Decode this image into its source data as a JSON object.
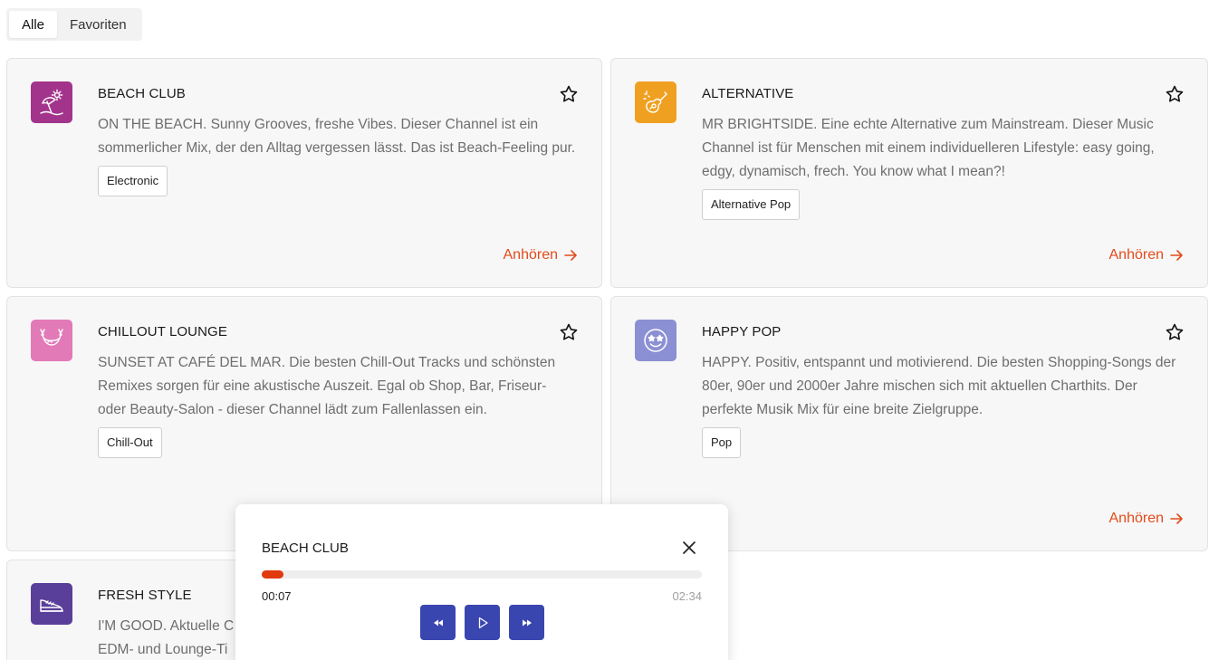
{
  "tabs": [
    {
      "label": "Alle",
      "active": true
    },
    {
      "label": "Favoriten",
      "active": false
    }
  ],
  "listen_label": "Anhören",
  "accent_color": "#e24b1c",
  "channels": [
    {
      "title": "BEACH CLUB",
      "description": "ON THE BEACH. Sunny Grooves, freshe Vibes. Dieser Channel ist ein sommerlicher Mix, der den Alltag vergessen lässt. Das ist Beach-Feeling pur.",
      "tag": "Electronic",
      "icon": "beach-umbrella-icon",
      "icon_color": "#a3348c"
    },
    {
      "title": "ALTERNATIVE",
      "description": "MR BRIGHTSIDE. Eine echte Alternative zum Mainstream. Dieser Music Channel ist für Menschen mit einem individuelleren Lifestyle: easy going, edgy, dynamisch, frech. You know what I mean?!",
      "tag": "Alternative Pop",
      "icon": "guitar-icon",
      "icon_color": "#f0a020"
    },
    {
      "title": "CHILLOUT LOUNGE",
      "description": "SUNSET AT CAFÉ DEL MAR. Die besten Chill-Out Tracks und schönsten Remixes sorgen für eine akustische Auszeit. Egal ob Shop, Bar, Friseur- oder Beauty-Salon - dieser Channel lädt zum Fallenlassen ein.",
      "tag": "Chill-Out",
      "icon": "hammock-icon",
      "icon_color": "#e27ab8"
    },
    {
      "title": "HAPPY POP",
      "description": "HAPPY. Positiv, entspannt und motivierend. Die besten Shopping-Songs der 80er, 90er und 2000er Jahre mischen sich mit aktuellen Charthits. Der perfekte Musik Mix für eine breite Zielgruppe.",
      "tag": "Pop",
      "icon": "star-eyes-smiley-icon",
      "icon_color": "#8b8fd4"
    },
    {
      "title": "FRESH STYLE",
      "description": "I'M GOOD. Aktuelle C",
      "description_line2": "EDM- und Lounge-Ti",
      "icon": "sneaker-icon",
      "icon_color": "#5a3f9a"
    }
  ],
  "player": {
    "title": "BEACH CLUB",
    "current_time": "00:07",
    "total_time": "02:34",
    "progress": 0.05,
    "progress_color": "#e03a0e",
    "button_color": "#3a46b0",
    "controls": [
      "rewind-icon",
      "play-icon",
      "fast-forward-icon"
    ]
  }
}
